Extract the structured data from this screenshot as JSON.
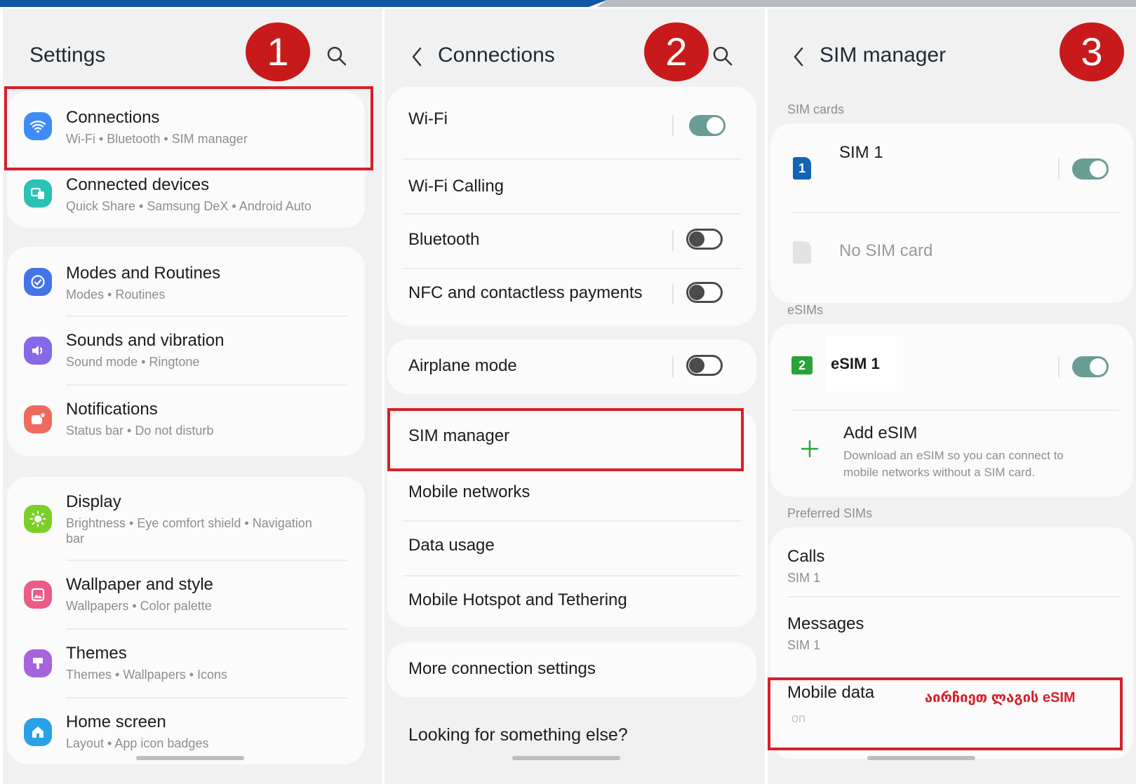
{
  "panel1": {
    "badge": "1",
    "title": "Settings",
    "items": [
      {
        "label": "Connections",
        "sub": "Wi-Fi  •  Bluetooth  •  SIM manager",
        "icon": "wifi-icon",
        "color": "#3f8cf5"
      },
      {
        "label": "Connected devices",
        "sub": "Quick Share  •  Samsung DeX  •  Android Auto",
        "icon": "devices-icon",
        "color": "#29c2b6"
      },
      {
        "label": "Modes and Routines",
        "sub": "Modes  •  Routines",
        "icon": "routines-icon",
        "color": "#4474e8"
      },
      {
        "label": "Sounds and vibration",
        "sub": "Sound mode  •  Ringtone",
        "icon": "volume-icon",
        "color": "#8569e6"
      },
      {
        "label": "Notifications",
        "sub": "Status bar  •  Do not disturb",
        "icon": "notification-icon",
        "color": "#ee6a5c"
      },
      {
        "label": "Display",
        "sub": "Brightness  •  Eye comfort shield  •  Navigation",
        "sub2": "bar",
        "icon": "brightness-icon",
        "color": "#7ccf2a"
      },
      {
        "label": "Wallpaper and style",
        "sub": "Wallpapers  •  Color palette",
        "icon": "wallpaper-icon",
        "color": "#eb5b86"
      },
      {
        "label": "Themes",
        "sub": "Themes  •  Wallpapers  •  Icons",
        "icon": "themes-icon",
        "color": "#a564dc"
      },
      {
        "label": "Home screen",
        "sub": "Layout  •  App icon badges",
        "icon": "home-icon",
        "color": "#2aa1e6"
      }
    ]
  },
  "panel2": {
    "badge": "2",
    "title": "Connections",
    "group1": [
      {
        "label": "Wi-Fi",
        "toggle": "on"
      },
      {
        "label": "Wi-Fi Calling"
      },
      {
        "label": "Bluetooth",
        "toggle": "off"
      },
      {
        "label": "NFC and contactless payments",
        "toggle": "off"
      }
    ],
    "airplane": {
      "label": "Airplane mode",
      "toggle": "off"
    },
    "group3": [
      {
        "label": "SIM manager"
      },
      {
        "label": "Mobile networks"
      },
      {
        "label": "Data usage"
      },
      {
        "label": "Mobile Hotspot and Tethering"
      }
    ],
    "more": "More connection settings",
    "looking": "Looking for something else?"
  },
  "panel3": {
    "badge": "3",
    "title": "SIM manager",
    "sim_cards_label": "SIM cards",
    "sim1": {
      "label": "SIM 1",
      "badge": "1",
      "toggle": "on"
    },
    "no_sim": "No SIM card",
    "esims_label": "eSIMs",
    "esim1": {
      "label": "eSIM 1",
      "badge": "2",
      "toggle": "on"
    },
    "add_esim": {
      "label": "Add eSIM",
      "desc1": "Download an eSIM so you can connect to",
      "desc2": "mobile networks without a SIM card."
    },
    "preferred_label": "Preferred SIMs",
    "calls": {
      "label": "Calls",
      "value": "SIM 1"
    },
    "messages": {
      "label": "Messages",
      "value": "SIM 1"
    },
    "mobile_data": {
      "label": "Mobile data",
      "value": "on",
      "annotation": "აირჩიეთ ლაგის eSIM"
    }
  },
  "colors": {
    "annotation_red": "#d6202a",
    "badge_red": "#c81a1a",
    "toggle_on": "#6a9d95",
    "sim_blue": "#1463b3",
    "esim_green": "#27a33a"
  }
}
